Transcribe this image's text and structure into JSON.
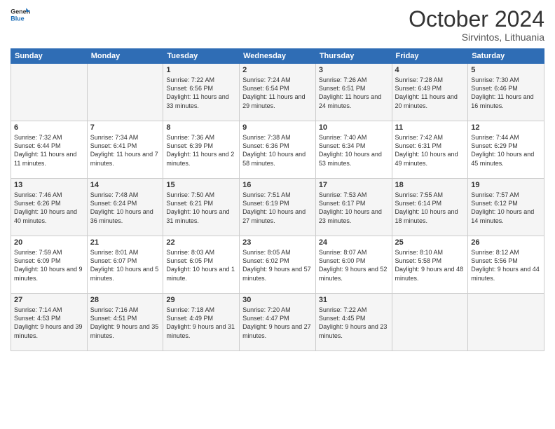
{
  "header": {
    "logo": {
      "general": "General",
      "blue": "Blue"
    },
    "title": "October 2024",
    "subtitle": "Sirvintos, Lithuania"
  },
  "weekdays": [
    "Sunday",
    "Monday",
    "Tuesday",
    "Wednesday",
    "Thursday",
    "Friday",
    "Saturday"
  ],
  "weeks": [
    [
      null,
      null,
      {
        "day": 1,
        "sunrise": "Sunrise: 7:22 AM",
        "sunset": "Sunset: 6:56 PM",
        "daylight": "Daylight: 11 hours and 33 minutes."
      },
      {
        "day": 2,
        "sunrise": "Sunrise: 7:24 AM",
        "sunset": "Sunset: 6:54 PM",
        "daylight": "Daylight: 11 hours and 29 minutes."
      },
      {
        "day": 3,
        "sunrise": "Sunrise: 7:26 AM",
        "sunset": "Sunset: 6:51 PM",
        "daylight": "Daylight: 11 hours and 24 minutes."
      },
      {
        "day": 4,
        "sunrise": "Sunrise: 7:28 AM",
        "sunset": "Sunset: 6:49 PM",
        "daylight": "Daylight: 11 hours and 20 minutes."
      },
      {
        "day": 5,
        "sunrise": "Sunrise: 7:30 AM",
        "sunset": "Sunset: 6:46 PM",
        "daylight": "Daylight: 11 hours and 16 minutes."
      }
    ],
    [
      {
        "day": 6,
        "sunrise": "Sunrise: 7:32 AM",
        "sunset": "Sunset: 6:44 PM",
        "daylight": "Daylight: 11 hours and 11 minutes."
      },
      {
        "day": 7,
        "sunrise": "Sunrise: 7:34 AM",
        "sunset": "Sunset: 6:41 PM",
        "daylight": "Daylight: 11 hours and 7 minutes."
      },
      {
        "day": 8,
        "sunrise": "Sunrise: 7:36 AM",
        "sunset": "Sunset: 6:39 PM",
        "daylight": "Daylight: 11 hours and 2 minutes."
      },
      {
        "day": 9,
        "sunrise": "Sunrise: 7:38 AM",
        "sunset": "Sunset: 6:36 PM",
        "daylight": "Daylight: 10 hours and 58 minutes."
      },
      {
        "day": 10,
        "sunrise": "Sunrise: 7:40 AM",
        "sunset": "Sunset: 6:34 PM",
        "daylight": "Daylight: 10 hours and 53 minutes."
      },
      {
        "day": 11,
        "sunrise": "Sunrise: 7:42 AM",
        "sunset": "Sunset: 6:31 PM",
        "daylight": "Daylight: 10 hours and 49 minutes."
      },
      {
        "day": 12,
        "sunrise": "Sunrise: 7:44 AM",
        "sunset": "Sunset: 6:29 PM",
        "daylight": "Daylight: 10 hours and 45 minutes."
      }
    ],
    [
      {
        "day": 13,
        "sunrise": "Sunrise: 7:46 AM",
        "sunset": "Sunset: 6:26 PM",
        "daylight": "Daylight: 10 hours and 40 minutes."
      },
      {
        "day": 14,
        "sunrise": "Sunrise: 7:48 AM",
        "sunset": "Sunset: 6:24 PM",
        "daylight": "Daylight: 10 hours and 36 minutes."
      },
      {
        "day": 15,
        "sunrise": "Sunrise: 7:50 AM",
        "sunset": "Sunset: 6:21 PM",
        "daylight": "Daylight: 10 hours and 31 minutes."
      },
      {
        "day": 16,
        "sunrise": "Sunrise: 7:51 AM",
        "sunset": "Sunset: 6:19 PM",
        "daylight": "Daylight: 10 hours and 27 minutes."
      },
      {
        "day": 17,
        "sunrise": "Sunrise: 7:53 AM",
        "sunset": "Sunset: 6:17 PM",
        "daylight": "Daylight: 10 hours and 23 minutes."
      },
      {
        "day": 18,
        "sunrise": "Sunrise: 7:55 AM",
        "sunset": "Sunset: 6:14 PM",
        "daylight": "Daylight: 10 hours and 18 minutes."
      },
      {
        "day": 19,
        "sunrise": "Sunrise: 7:57 AM",
        "sunset": "Sunset: 6:12 PM",
        "daylight": "Daylight: 10 hours and 14 minutes."
      }
    ],
    [
      {
        "day": 20,
        "sunrise": "Sunrise: 7:59 AM",
        "sunset": "Sunset: 6:09 PM",
        "daylight": "Daylight: 10 hours and 9 minutes."
      },
      {
        "day": 21,
        "sunrise": "Sunrise: 8:01 AM",
        "sunset": "Sunset: 6:07 PM",
        "daylight": "Daylight: 10 hours and 5 minutes."
      },
      {
        "day": 22,
        "sunrise": "Sunrise: 8:03 AM",
        "sunset": "Sunset: 6:05 PM",
        "daylight": "Daylight: 10 hours and 1 minute."
      },
      {
        "day": 23,
        "sunrise": "Sunrise: 8:05 AM",
        "sunset": "Sunset: 6:02 PM",
        "daylight": "Daylight: 9 hours and 57 minutes."
      },
      {
        "day": 24,
        "sunrise": "Sunrise: 8:07 AM",
        "sunset": "Sunset: 6:00 PM",
        "daylight": "Daylight: 9 hours and 52 minutes."
      },
      {
        "day": 25,
        "sunrise": "Sunrise: 8:10 AM",
        "sunset": "Sunset: 5:58 PM",
        "daylight": "Daylight: 9 hours and 48 minutes."
      },
      {
        "day": 26,
        "sunrise": "Sunrise: 8:12 AM",
        "sunset": "Sunset: 5:56 PM",
        "daylight": "Daylight: 9 hours and 44 minutes."
      }
    ],
    [
      {
        "day": 27,
        "sunrise": "Sunrise: 7:14 AM",
        "sunset": "Sunset: 4:53 PM",
        "daylight": "Daylight: 9 hours and 39 minutes."
      },
      {
        "day": 28,
        "sunrise": "Sunrise: 7:16 AM",
        "sunset": "Sunset: 4:51 PM",
        "daylight": "Daylight: 9 hours and 35 minutes."
      },
      {
        "day": 29,
        "sunrise": "Sunrise: 7:18 AM",
        "sunset": "Sunset: 4:49 PM",
        "daylight": "Daylight: 9 hours and 31 minutes."
      },
      {
        "day": 30,
        "sunrise": "Sunrise: 7:20 AM",
        "sunset": "Sunset: 4:47 PM",
        "daylight": "Daylight: 9 hours and 27 minutes."
      },
      {
        "day": 31,
        "sunrise": "Sunrise: 7:22 AM",
        "sunset": "Sunset: 4:45 PM",
        "daylight": "Daylight: 9 hours and 23 minutes."
      },
      null,
      null
    ]
  ]
}
